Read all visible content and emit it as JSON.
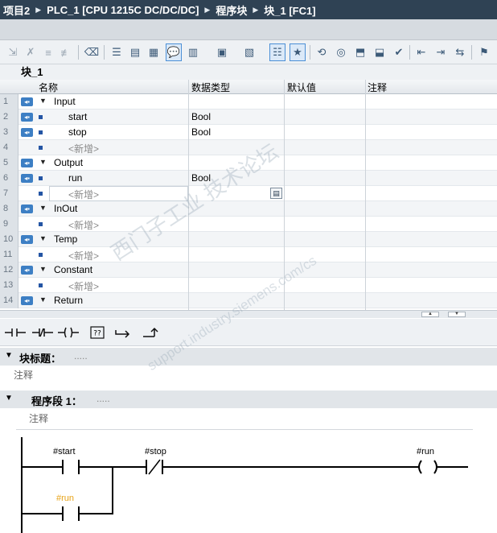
{
  "breadcrumb": [
    "项目2",
    "PLC_1 [CPU 1215C DC/DC/DC]",
    "程序块",
    "块_1 [FC1]"
  ],
  "block_name": "块_1",
  "columns": {
    "name": "名称",
    "datatype": "数据类型",
    "default": "默认值",
    "comment": "注释"
  },
  "rows": [
    {
      "no": "1",
      "type": "section",
      "name": "Input",
      "datatype": ""
    },
    {
      "no": "2",
      "type": "var",
      "name": "start",
      "datatype": "Bool"
    },
    {
      "no": "3",
      "type": "var",
      "name": "stop",
      "datatype": "Bool"
    },
    {
      "no": "4",
      "type": "add",
      "name": "<新增>",
      "datatype": ""
    },
    {
      "no": "5",
      "type": "section",
      "name": "Output",
      "datatype": ""
    },
    {
      "no": "6",
      "type": "var",
      "name": "run",
      "datatype": "Bool"
    },
    {
      "no": "7",
      "type": "add-edit",
      "name": "<新增>",
      "datatype": ""
    },
    {
      "no": "8",
      "type": "section",
      "name": "InOut",
      "datatype": ""
    },
    {
      "no": "9",
      "type": "add",
      "name": "<新增>",
      "datatype": ""
    },
    {
      "no": "10",
      "type": "section",
      "name": "Temp",
      "datatype": ""
    },
    {
      "no": "11",
      "type": "add",
      "name": "<新增>",
      "datatype": ""
    },
    {
      "no": "12",
      "type": "section",
      "name": "Constant",
      "datatype": ""
    },
    {
      "no": "13",
      "type": "add",
      "name": "<新增>",
      "datatype": ""
    },
    {
      "no": "14",
      "type": "section",
      "name": "Return",
      "datatype": ""
    }
  ],
  "block_title": {
    "label": "块标题：",
    "placeholder": ".....",
    "comment": "注释"
  },
  "network": {
    "label": "程序段 1：",
    "placeholder": ".....",
    "comment": "注释"
  },
  "ladder": {
    "contact1": "#start",
    "contact2": "#stop",
    "coil": "#run",
    "parallel": "#run"
  },
  "watermark": {
    "cn": "西门子工业  技术论坛",
    "en": "support.industry.siemens.com/cs"
  },
  "colors": {
    "title_bg": "#2f4254",
    "accent": "#3d7fc4",
    "parallel_tag": "#e8a317"
  }
}
